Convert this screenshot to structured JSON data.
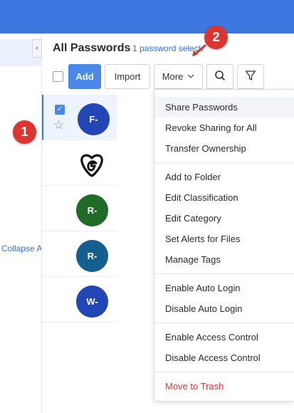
{
  "colors": {
    "topbar": "#3d78e0",
    "accent": "#4a89e8",
    "danger": "#d23b3b",
    "badge": "#d93632"
  },
  "left_pane": {
    "collapse_all_label": "Collapse All"
  },
  "header": {
    "title": "All Passwords",
    "selected_count": "1 password selected"
  },
  "toolbar": {
    "add_label": "Add",
    "import_label": "Import",
    "more_label": "More",
    "search_icon": "search-icon",
    "filter_icon": "filter-icon"
  },
  "rows": [
    {
      "initial": "F-",
      "color": "#2346b5",
      "selected": true
    },
    {
      "initial": "",
      "logo": "godaddy-logo",
      "selected": false
    },
    {
      "initial": "R-",
      "color": "#1f6b27",
      "selected": false
    },
    {
      "initial": "R-",
      "color": "#155f8e",
      "selected": false
    },
    {
      "initial": "W-",
      "color": "#2346b5",
      "selected": false
    }
  ],
  "menu": {
    "groups": [
      [
        "Share Passwords",
        "Revoke Sharing for All",
        "Transfer Ownership"
      ],
      [
        "Add to Folder",
        "Edit Classification",
        "Edit Category",
        "Set Alerts for Files",
        "Manage Tags"
      ],
      [
        "Enable Auto Login",
        "Disable Auto Login"
      ],
      [
        "Enable Access Control",
        "Disable Access Control"
      ],
      [
        "Move to Trash"
      ]
    ]
  },
  "badges": {
    "first": "1",
    "second": "2"
  }
}
